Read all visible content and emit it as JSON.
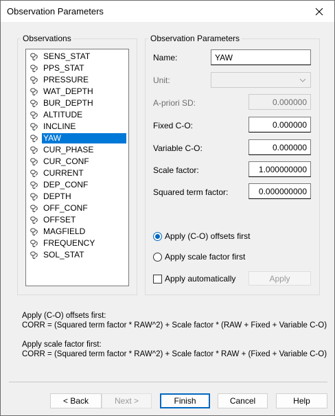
{
  "window": {
    "title": "Observation Parameters"
  },
  "observations": {
    "group_label": "Observations",
    "items": [
      "SENS_STAT",
      "PPS_STAT",
      "PRESSURE",
      "WAT_DEPTH",
      "BUR_DEPTH",
      "ALTITUDE",
      "INCLINE",
      "YAW",
      "CUR_PHASE",
      "CUR_CONF",
      "CURRENT",
      "DEP_CONF",
      "DEPTH",
      "OFF_CONF",
      "OFFSET",
      "MAGFIELD",
      "FREQUENCY",
      "SOL_STAT"
    ],
    "selected": "YAW",
    "item_icon": "sensor-probe-icon"
  },
  "params": {
    "group_label": "Observation Parameters",
    "name_label": "Name:",
    "name_value": "YAW",
    "unit_label": "Unit:",
    "unit_value": "",
    "apriori_label": "A-priori SD:",
    "apriori_value": "0.000000",
    "fixed_label": "Fixed C-O:",
    "fixed_value": "0.000000",
    "variable_label": "Variable C-O:",
    "variable_value": "0.000000",
    "scale_label": "Scale factor:",
    "scale_value": "1.000000000",
    "squared_label": "Squared term factor:",
    "squared_value": "0.000000000",
    "radio_offsets_first": "Apply (C-O) offsets first",
    "radio_scale_first": "Apply scale factor first",
    "selected_radio": "offsets_first",
    "apply_auto_label": "Apply automatically",
    "apply_auto_checked": false,
    "apply_button": "Apply"
  },
  "notes": {
    "offsets_heading": "Apply (C-O) offsets first:",
    "offsets_formula": "CORR = (Squared term factor * RAW^2) + Scale factor * (RAW + Fixed + Variable C-O)",
    "scale_heading": "Apply scale factor first:",
    "scale_formula": "CORR = (Squared term factor * RAW^2) + Scale factor * RAW + (Fixed + Variable C-O)"
  },
  "buttons": {
    "back": "< Back",
    "next": "Next >",
    "finish": "Finish",
    "cancel": "Cancel",
    "help": "Help"
  },
  "colors": {
    "selection": "#0078d7",
    "accent": "#0067c0"
  }
}
